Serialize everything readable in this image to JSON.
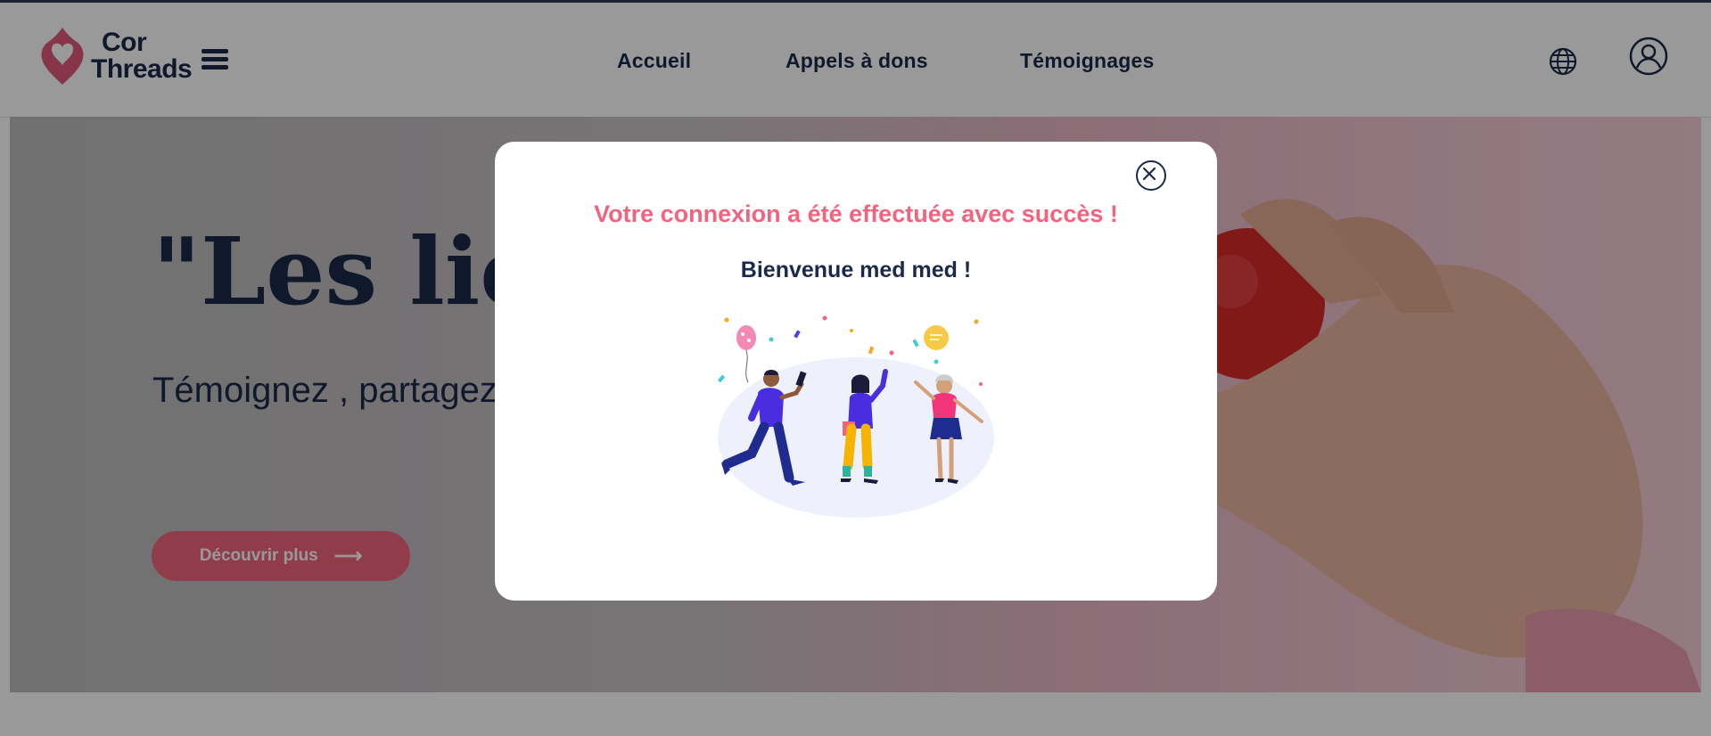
{
  "header": {
    "logo": {
      "line1": "Cor",
      "line2": "Threads",
      "brand_color": "#e15a7a"
    },
    "menu_icon": "hamburger-icon",
    "nav": [
      {
        "label": "Accueil"
      },
      {
        "label": "Appels à dons"
      },
      {
        "label": "Témoignages"
      }
    ],
    "language_icon": "globe-icon",
    "account_icon": "user-icon"
  },
  "hero": {
    "title": "\"Les liens",
    "subtitle": "Témoignez , partagez les liens du don",
    "cta_label": "Découvrir plus",
    "cta_icon": "arrow-right-icon"
  },
  "modal": {
    "title": "Votre connexion a été effectuée avec succès !",
    "welcome": "Bienvenue med med !",
    "close_icon": "close-icon",
    "illustration": "celebration-illustration"
  },
  "colors": {
    "primary_text": "#1b2a4a",
    "accent": "#f2647e"
  }
}
